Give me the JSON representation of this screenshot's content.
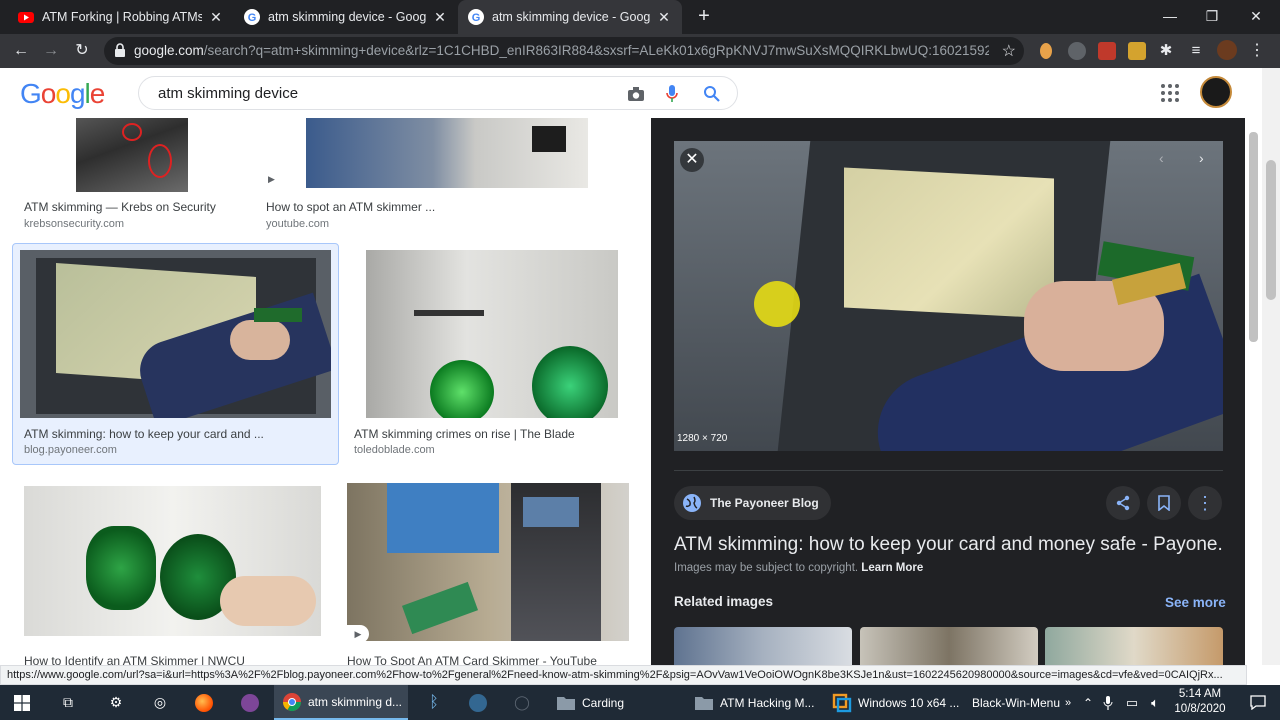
{
  "browser": {
    "tabs": [
      {
        "title": "ATM Forking | Robbing ATMs Usi",
        "favicon": "youtube-icon",
        "active": false
      },
      {
        "title": "atm skimming device - Google S",
        "favicon": "google-icon",
        "active": false
      },
      {
        "title": "atm skimming device - Google S",
        "favicon": "google-icon",
        "active": true
      }
    ],
    "url_host": "google.com",
    "url_rest": "/search?q=atm+skimming+device&rlz=1C1CHBD_enIR863IR884&sxsrf=ALeKk01x6gRpKNVJ7mwSuXsMQQIRKLbwUQ:160215921678..."
  },
  "google": {
    "logo": "Google",
    "query": "atm skimming device"
  },
  "results": [
    {
      "caption": "ATM skimming — Krebs on Security",
      "source": "krebsonsecurity.com"
    },
    {
      "caption": "How to spot an ATM skimmer ...",
      "source": "youtube.com"
    },
    {
      "caption": "ATM skimming: how to keep your card and ...",
      "source": "blog.payoneer.com"
    },
    {
      "caption": "ATM skimming crimes on rise | The Blade",
      "source": "toledoblade.com"
    },
    {
      "caption": "How to Identify an ATM Skimmer | NWCU",
      "source": ""
    },
    {
      "caption": "How To Spot An ATM Card Skimmer - YouTube",
      "source": ""
    }
  ],
  "preview": {
    "dimensions": "1280 × 720",
    "site": "The Payoneer Blog",
    "title": "ATM skimming: how to keep your card and money safe - Payone...",
    "copyright": "Images may be subject to copyright.",
    "learn_more": "Learn More",
    "related_label": "Related images",
    "see_more": "See more"
  },
  "status_url": "https://www.google.com/url?sa=i&url=https%3A%2F%2Fblog.payoneer.com%2Fhow-to%2Fgeneral%2Fneed-know-atm-skimming%2F&psig=AOvVaw1VeOoiOWOgnK8be3KSJe1n&ust=1602245620980000&source=images&cd=vfe&ved=0CAIQjRx...",
  "taskbar": {
    "apps": [
      {
        "label": "atm skimming d...",
        "active": true
      },
      {
        "label": "Carding",
        "active": false
      },
      {
        "label": "ATM Hacking M...",
        "active": false
      },
      {
        "label": "Windows 10 x64 ...",
        "active": false
      },
      {
        "label": "Black-Win-Menu",
        "active": false
      }
    ],
    "time": "5:14 AM",
    "date": "10/8/2020"
  },
  "colors": {
    "chrome_dark": "#202124",
    "chrome_toolbar": "#35363a",
    "link_blue": "#8ab4f8",
    "google_blue": "#4285f4",
    "google_red": "#ea4335",
    "google_yellow": "#fbbc05",
    "google_green": "#34a853"
  }
}
